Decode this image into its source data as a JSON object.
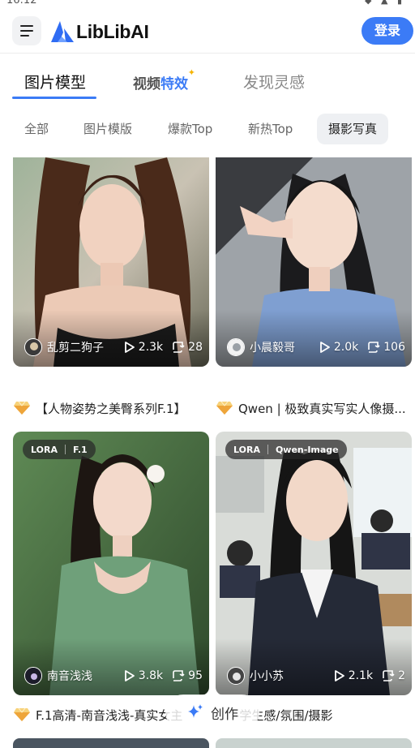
{
  "status_bar": {
    "time": "16:12",
    "icons": "◆ ▲ ▮"
  },
  "header": {
    "logo_text": "LibLibAI",
    "login_label": "登录"
  },
  "tabs": [
    {
      "label": "图片模型",
      "active": true
    },
    {
      "label_plain": "视频",
      "label_highlight": "特效",
      "spark": "✦"
    },
    {
      "label": "发现灵感"
    }
  ],
  "chips": [
    "全部",
    "图片模版",
    "爆款Top",
    "新热Top",
    "摄影写真"
  ],
  "active_chip": "摄影写真",
  "cards": [
    {
      "author": "乱剪二狗子",
      "plays": "2.3k",
      "remixes": "28",
      "title": "【人物姿势之美臀系列F.1】"
    },
    {
      "author": "小晨毅哥",
      "plays": "2.0k",
      "remixes": "106",
      "title": "Qwen | 极致真实写实人像摄..."
    },
    {
      "badges": [
        "LORA",
        "F.1"
      ],
      "author": "南音浅浅",
      "plays": "3.8k",
      "remixes": "95",
      "title": "F.1高清-南音浅浅-真实女主"
    },
    {
      "badges": [
        "LORA",
        "Qwen-Image"
      ],
      "author": "小小苏",
      "plays": "2.1k",
      "remixes": "2",
      "title": "-学生感/氛围/摄影"
    }
  ],
  "create_button": {
    "label": "创作"
  },
  "colors": {
    "accent": "#3b7bf6",
    "chip_bg": "#eef0f3",
    "gem": "#f4b942"
  },
  "icons": [
    "menu-icon",
    "liblib-logo-icon",
    "play-icon",
    "remix-icon",
    "gem-icon",
    "sparkle-icon"
  ]
}
